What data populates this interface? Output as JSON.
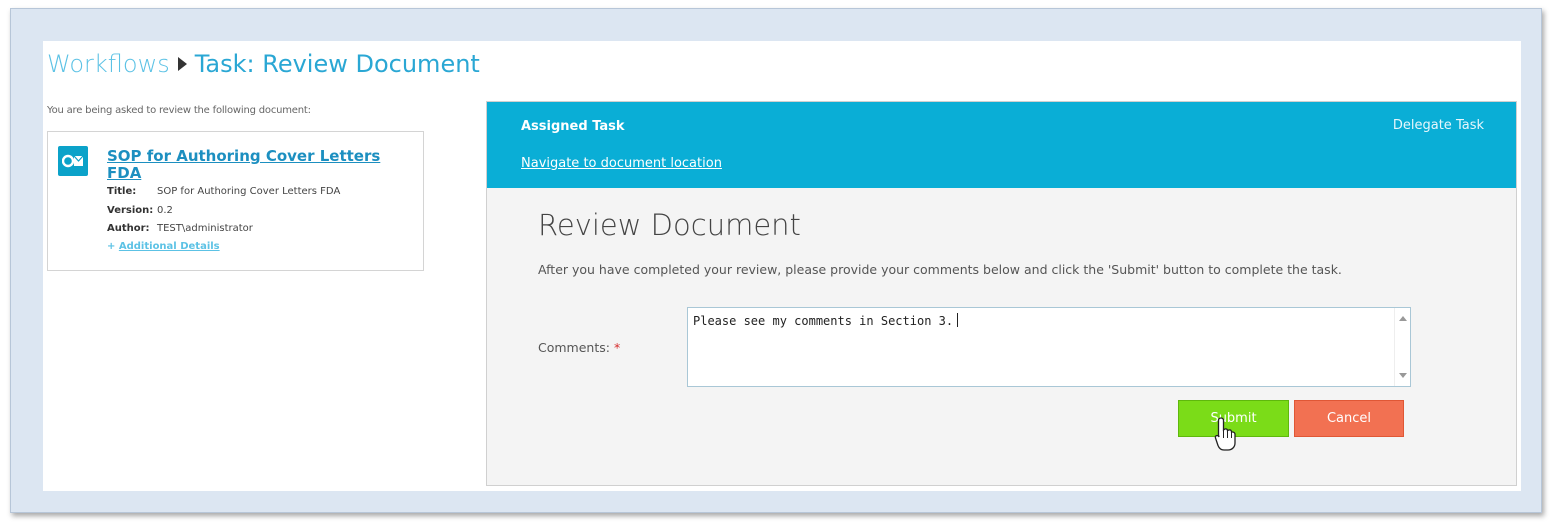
{
  "breadcrumb": {
    "root": "Workflows",
    "current": "Task: Review Document"
  },
  "document_panel": {
    "intro": "You are being asked to review the following document:",
    "title": "SOP for Authoring Cover Letters FDA",
    "title_label": "Title:",
    "title_value": "SOP for Authoring Cover Letters FDA",
    "version_label": "Version:",
    "version_value": "0.2",
    "author_label": "Author:",
    "author_value": "TEST\\administrator",
    "additional_prefix": "+",
    "additional_details": "Additional Details",
    "icon": "outlook-document-icon"
  },
  "task": {
    "assigned_label": "Assigned Task",
    "delegate_label": "Delegate Task",
    "navigate_label": "Navigate to document location",
    "form_title": "Review Document",
    "instructions": "After you have completed your review, please provide your comments below and click the 'Submit' button to complete the task.",
    "comments_label": "Comments:",
    "required_marker": "*",
    "comments_value": "Please see my comments in Section 3.",
    "submit_label": "Submit",
    "cancel_label": "Cancel"
  },
  "colors": {
    "accent": "#0aaed6",
    "link": "#1c8fc0",
    "submit": "#7bdc18",
    "cancel": "#f27152",
    "required": "#d62b2b"
  }
}
